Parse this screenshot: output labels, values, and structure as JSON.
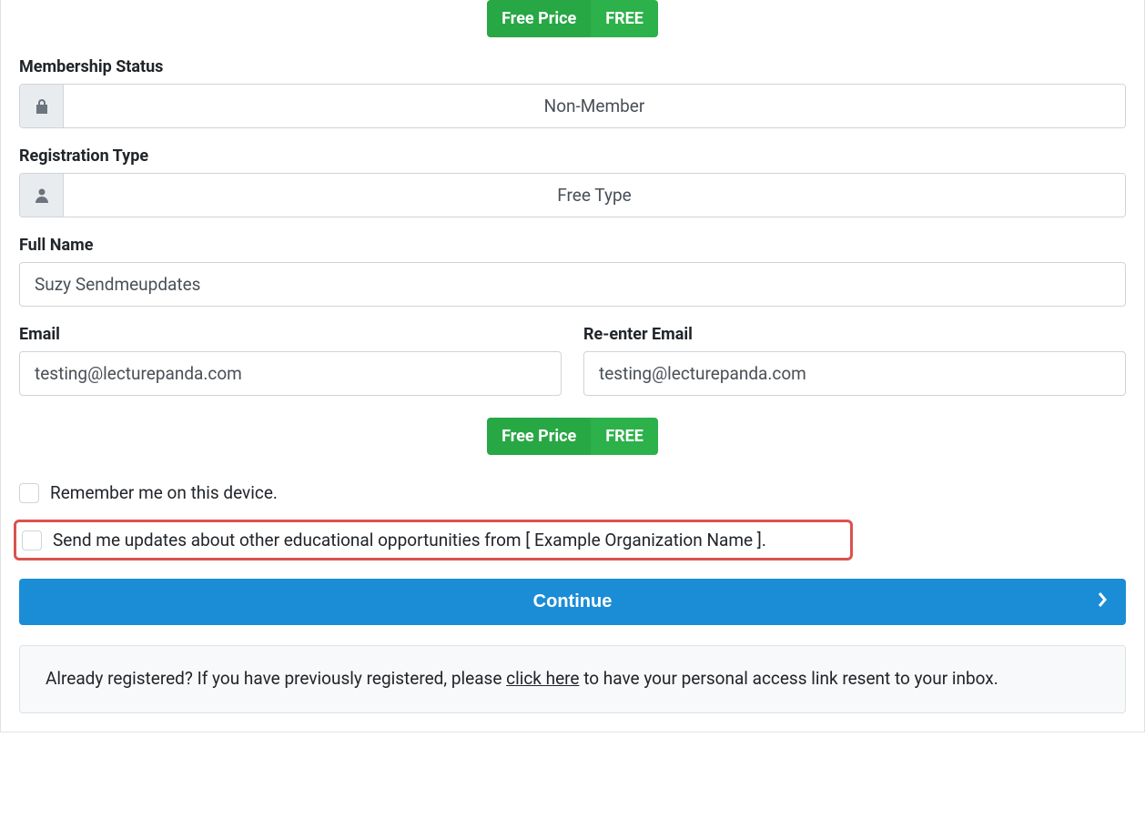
{
  "price_pill": {
    "left": "Free Price",
    "right": "FREE"
  },
  "membership_status": {
    "label": "Membership Status",
    "value": "Non-Member"
  },
  "registration_type": {
    "label": "Registration Type",
    "value": "Free Type"
  },
  "full_name": {
    "label": "Full Name",
    "value": "Suzy Sendmeupdates"
  },
  "email": {
    "label": "Email",
    "value": "testing@lecturepanda.com"
  },
  "reenter_email": {
    "label": "Re-enter Email",
    "value": "testing@lecturepanda.com"
  },
  "remember_me": {
    "label": "Remember me on this device."
  },
  "send_updates": {
    "label": "Send me updates about other educational opportunities from [ Example Organization Name ]."
  },
  "continue_label": "Continue",
  "already_registered": {
    "prefix": "Already registered? If you have previously registered, please ",
    "link": "click here",
    "suffix": " to have your personal access link resent to your inbox."
  }
}
